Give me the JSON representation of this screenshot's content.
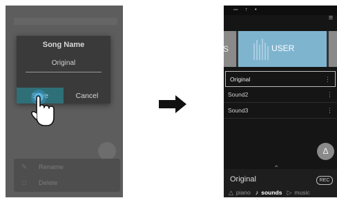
{
  "left_screen": {
    "dialog": {
      "title": "Song Name",
      "value": "Original",
      "save_label": "Save",
      "cancel_label": "Cancel"
    },
    "context_menu": {
      "rename_label": "Rename",
      "delete_label": "Delete"
    }
  },
  "right_screen": {
    "status_icons": "⎓ ↑ •",
    "menu_icon": "≡",
    "carousel": {
      "prev_partial_label": "S",
      "user_label": "USER"
    },
    "sounds": [
      {
        "label": "Original",
        "selected": true
      },
      {
        "label": "Sound2",
        "selected": false
      },
      {
        "label": "Sound3",
        "selected": false
      }
    ],
    "current_song": "Original",
    "rec_label": "REC",
    "nav": {
      "piano": "piano",
      "sounds": "sounds",
      "music": "music"
    }
  },
  "colors": {
    "accent_teal": "#2f6f78",
    "user_card": "#7fb4cf",
    "left_overlay": "#5d5d5d",
    "right_bg": "#151515"
  }
}
